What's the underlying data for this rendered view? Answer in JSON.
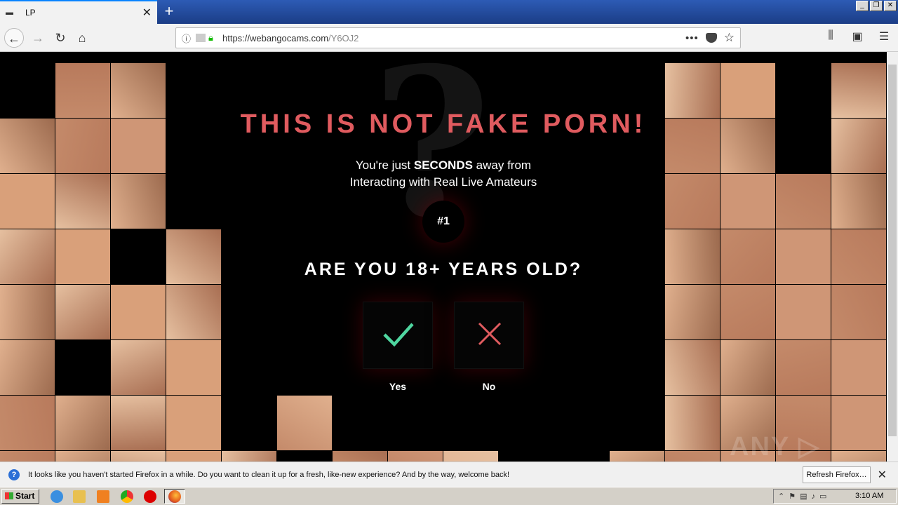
{
  "browser": {
    "tab_title": "LP",
    "url_host": "https://webangocams.com",
    "url_path": "/Y6OJ2"
  },
  "page": {
    "headline": "THIS IS NOT FAKE PORN!",
    "subline_pre": "You're just ",
    "subline_bold": "SECONDS",
    "subline_post": " away from",
    "subline_line2": "Interacting with Real Live Amateurs",
    "step": "#1",
    "question": "ARE YOU 18+ YEARS OLD?",
    "yes_label": "Yes",
    "no_label": "No",
    "yes_color": "#4fd6a0",
    "no_color": "#e05b5f",
    "headline_color": "#e05b5f",
    "watermark": "ANY.RUN"
  },
  "notification": {
    "text": "It looks like you haven't started Firefox in a while. Do you want to clean it up for a fresh, like-new experience? And by the way, welcome back!",
    "button": "Refresh Firefox…"
  },
  "taskbar": {
    "start": "Start",
    "clock": "3:10 AM"
  }
}
